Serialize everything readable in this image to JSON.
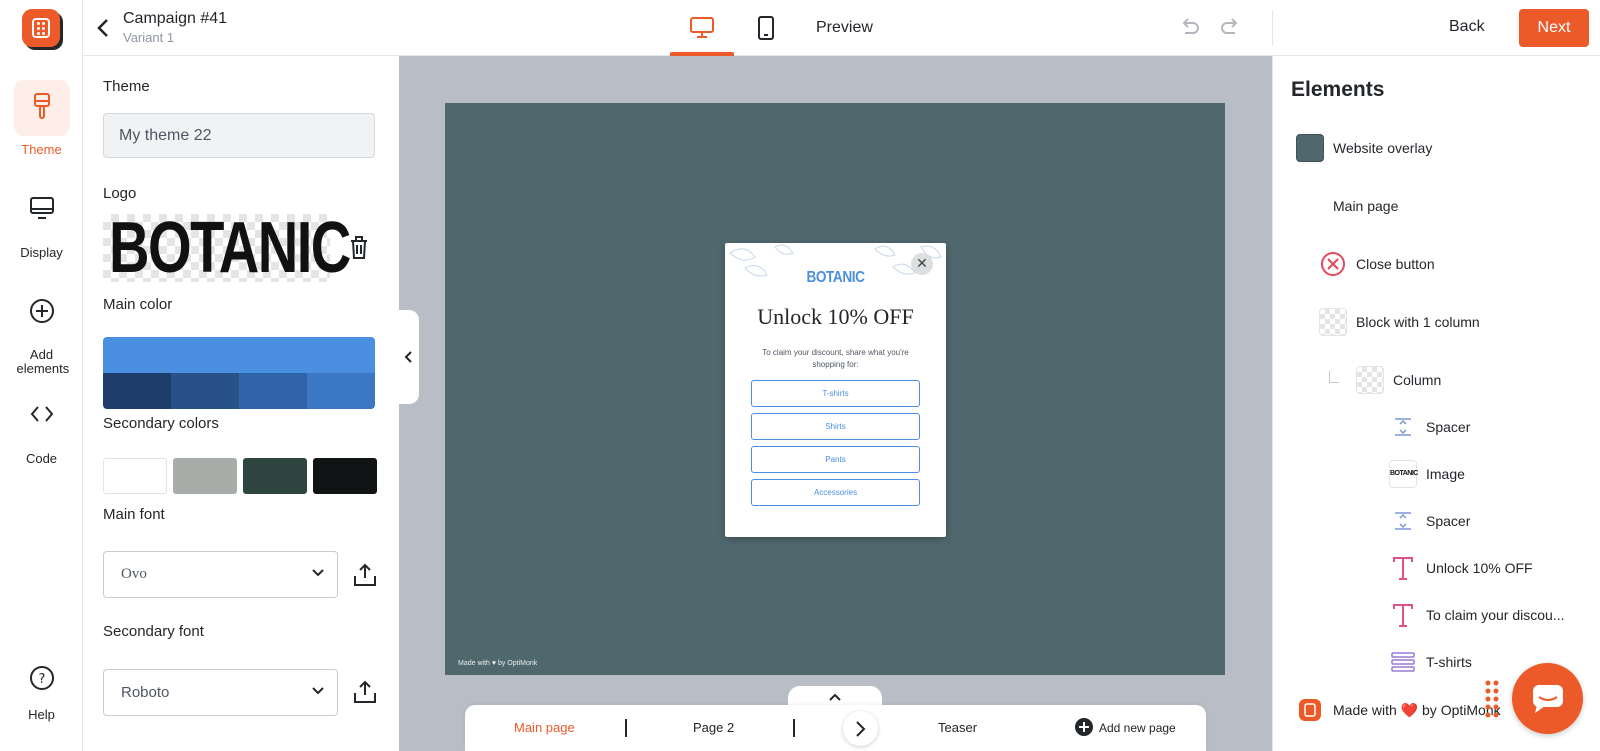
{
  "header": {
    "campaign_title": "Campaign #41",
    "variant": "Variant 1",
    "preview_label": "Preview",
    "back_label": "Back",
    "next_label": "Next"
  },
  "rail": {
    "items": [
      {
        "label": "Theme",
        "icon": "brush-icon",
        "active": true
      },
      {
        "label": "Display",
        "icon": "monitor-icon"
      },
      {
        "label": "Add elements",
        "icon": "plus-circle-icon"
      },
      {
        "label": "Code",
        "icon": "code-icon"
      },
      {
        "label": "Help",
        "icon": "help-icon"
      }
    ]
  },
  "theme_panel": {
    "theme_heading": "Theme",
    "theme_value": "My theme 22",
    "logo_heading": "Logo",
    "logo_text": "BOTANIC",
    "main_color_heading": "Main color",
    "main_color": "#4a8fe0",
    "main_color_shades": [
      "#1f3d6a",
      "#285189",
      "#3064a8",
      "#3b77c4"
    ],
    "secondary_colors_heading": "Secondary colors",
    "secondary_colors": [
      "#ffffff",
      "#a8adaa",
      "#2e4540",
      "#111414"
    ],
    "main_font_heading": "Main font",
    "main_font_value": "Ovo",
    "secondary_font_heading": "Secondary font",
    "secondary_font_value": "Roboto"
  },
  "popup": {
    "brand": "BOTANIC",
    "headline": "Unlock 10% OFF",
    "subtext": "To claim your discount, share what you're shopping for:",
    "options": [
      "T-shirts",
      "Shirts",
      "Pants",
      "Accessories"
    ],
    "footer": "Made with ♥ by OptiMonk",
    "overlay_color": "#4f686e"
  },
  "pages": {
    "items": [
      "Main page",
      "Page 2",
      "Teaser"
    ],
    "active": "Main page",
    "add_label": "Add new page"
  },
  "elements_panel": {
    "title": "Elements",
    "items": [
      {
        "label": "Website overlay",
        "icon": "overlay-swatch-icon"
      },
      {
        "label": "Main page",
        "icon": "none"
      },
      {
        "label": "Close button",
        "icon": "close-circle-icon"
      },
      {
        "label": "Block with 1 column",
        "icon": "checker-block-icon"
      },
      {
        "label": "Column",
        "icon": "checker-column-icon"
      },
      {
        "label": "Spacer",
        "icon": "spacer-icon"
      },
      {
        "label": "Image",
        "icon": "image-thumbnail-icon"
      },
      {
        "label": "Spacer",
        "icon": "spacer-icon"
      },
      {
        "label": "Unlock 10% OFF",
        "icon": "text-icon"
      },
      {
        "label": "To claim your discou...",
        "icon": "text-icon"
      },
      {
        "label": "T-shirts",
        "icon": "survey-icon"
      },
      {
        "label": "Made with ❤️ by OptiMonk",
        "icon": "optimonk-logo-icon"
      }
    ]
  },
  "colors": {
    "accent": "#ed5a29",
    "text": "#23262a",
    "canvas_bg": "#b9bdc6"
  }
}
